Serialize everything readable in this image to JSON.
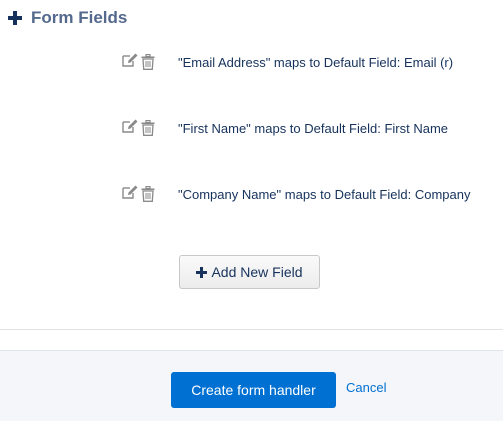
{
  "section": {
    "icon": "plus-icon",
    "title": "Form Fields"
  },
  "fields": [
    {
      "label": "\"Email Address\" maps to Default Field: Email (r)",
      "edit_icon": "edit-icon",
      "delete_icon": "trash-icon"
    },
    {
      "label": "\"First Name\" maps to Default Field: First Name",
      "edit_icon": "edit-icon",
      "delete_icon": "trash-icon"
    },
    {
      "label": "\"Company Name\" maps to Default Field: Company",
      "edit_icon": "edit-icon",
      "delete_icon": "trash-icon"
    }
  ],
  "add_field_button": {
    "icon": "plus-icon",
    "label": "Add New Field"
  },
  "footer": {
    "primary_button": "Create form handler",
    "cancel_link": "Cancel"
  },
  "colors": {
    "primary": "#0070d2",
    "text": "#16325c",
    "icon_gray": "#8a8a8a",
    "footer_bg": "#f4f6f9"
  }
}
